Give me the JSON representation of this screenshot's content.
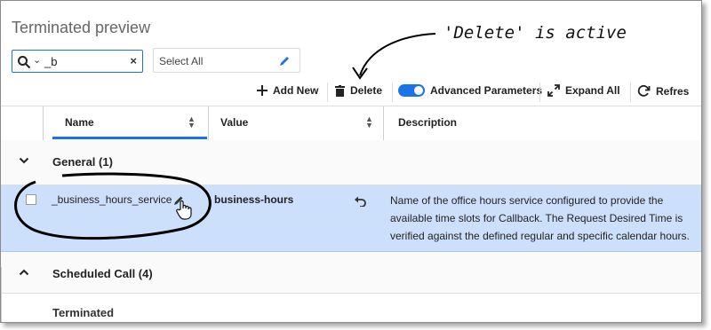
{
  "page_title": "Terminated preview",
  "search": {
    "value": "_b"
  },
  "select_all": {
    "label": "Select All"
  },
  "toolbar": {
    "add_new": "Add New",
    "delete": "Delete",
    "advanced_parameters": "Advanced Parameters",
    "expand_all": "Expand All",
    "refresh": "Refres"
  },
  "table": {
    "headers": {
      "name": "Name",
      "value": "Value",
      "description": "Description"
    },
    "groups": [
      {
        "label": "General (1)"
      },
      {
        "label": "Scheduled Call (4)"
      },
      {
        "label": "Terminated"
      }
    ],
    "row": {
      "name": "_business_hours_service",
      "value": "business-hours",
      "description": "Name of the office hours service configured to provide the available time slots for Callback. The Request Desired Time is verified against the defined regular and specific calendar hours."
    }
  },
  "annotation": {
    "text": "'Delete' is active"
  },
  "colors": {
    "accent": "#1a73e8",
    "selected_row": "#cde0fb"
  }
}
